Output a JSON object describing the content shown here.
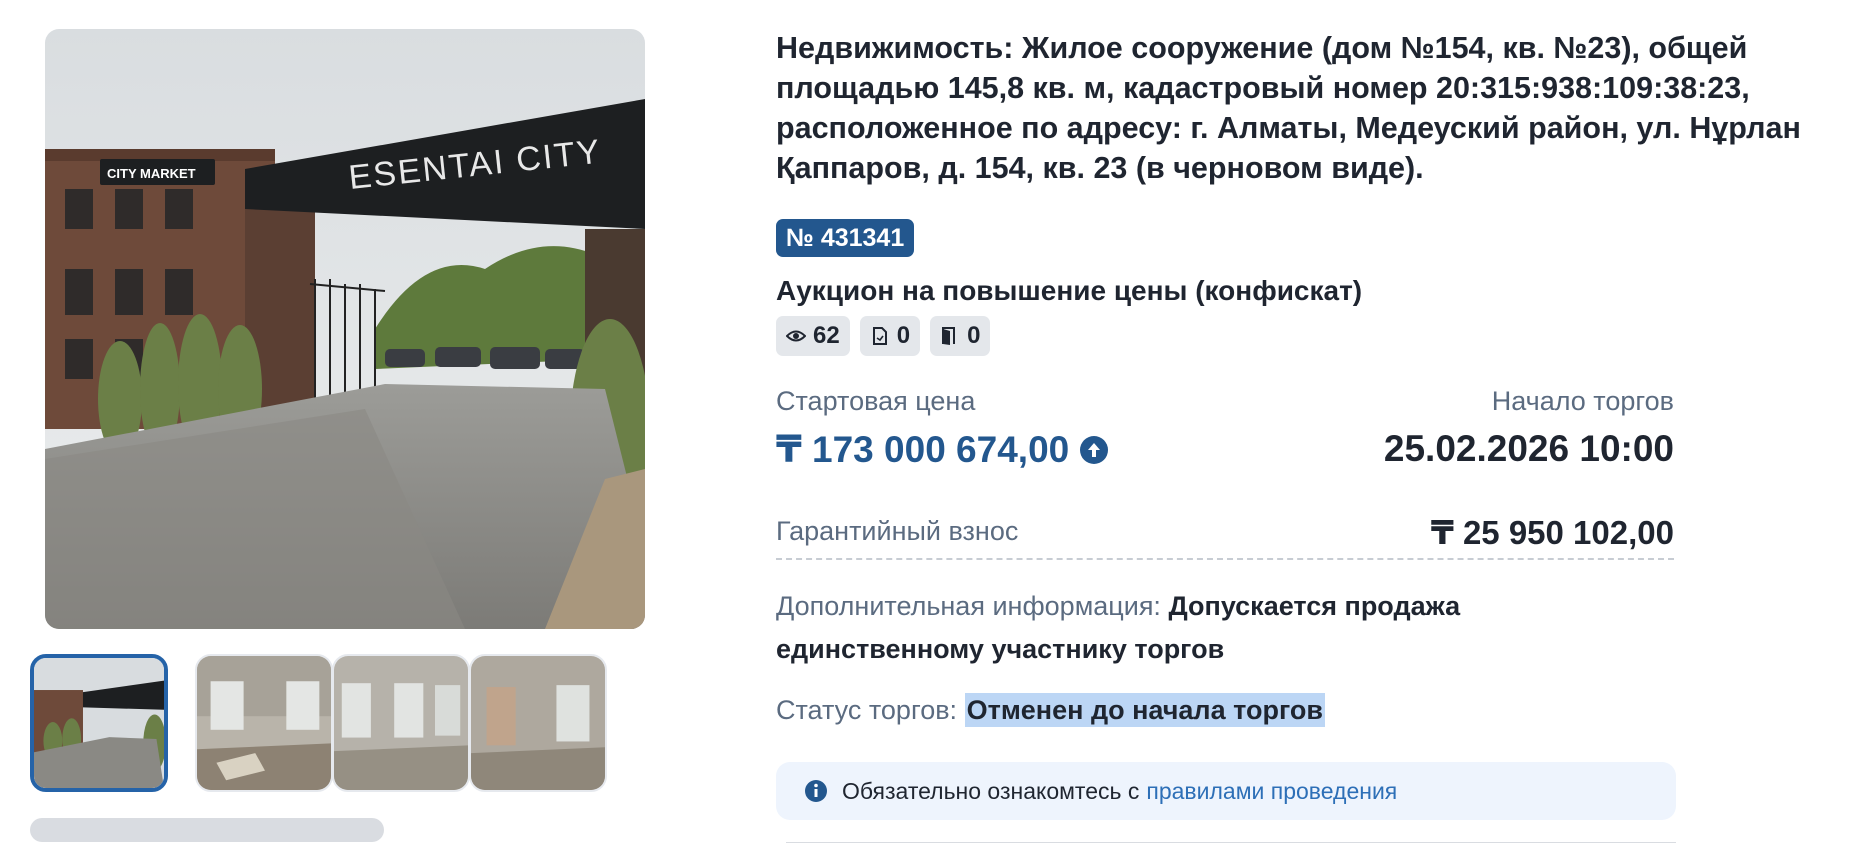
{
  "gallery": {
    "main_image": {
      "sign_text": "ESENTAI CITY",
      "store_sign": "CITY MARKET"
    },
    "thumbnails": [
      {
        "label": "thumbnail-1",
        "active": true
      },
      {
        "label": "thumbnail-2",
        "active": false
      },
      {
        "label": "thumbnail-3",
        "active": false
      },
      {
        "label": "thumbnail-4",
        "active": false
      }
    ]
  },
  "lot": {
    "title": "Недвижимость: Жилое сооружение (дом №154, кв. №23), общей площадью 145,8 кв. м, кадастровый номер 20:315:938:109:38:23, расположенное по адресу: г. Алматы, Медеуский район, ул. Нұрлан Қаппаров, д. 154, кв. 23 (в черновом виде).",
    "number": "№ 431341",
    "auction_type": "Аукцион на повышение цены (конфискат)",
    "stats": {
      "views": {
        "icon": "eye-icon",
        "value": "62"
      },
      "applications": {
        "icon": "document-icon",
        "value": "0"
      },
      "participants": {
        "icon": "door-icon",
        "value": "0"
      }
    },
    "start_price": {
      "label": "Стартовая цена",
      "value": "₸ 173 000 674,00",
      "icon": "arrow-up-circle-icon"
    },
    "trade_start": {
      "label": "Начало торгов",
      "value": "25.02.2026 10:00"
    },
    "deposit": {
      "label": "Гарантийный взнос",
      "value": "₸ 25 950 102,00"
    },
    "additional_info": {
      "label": "Дополнительная информация:",
      "value": "Допускается продажа единственному участнику торгов"
    },
    "status": {
      "label": "Статус торгов:",
      "value": "Отменен до начала торгов"
    },
    "notice": {
      "text": "Обязательно ознакомтесь с",
      "link": "правилами проведения",
      "icon": "info-icon"
    }
  },
  "colors": {
    "accent": "#23578e",
    "link": "#2d6fb7",
    "highlight": "#bcd6f5"
  }
}
